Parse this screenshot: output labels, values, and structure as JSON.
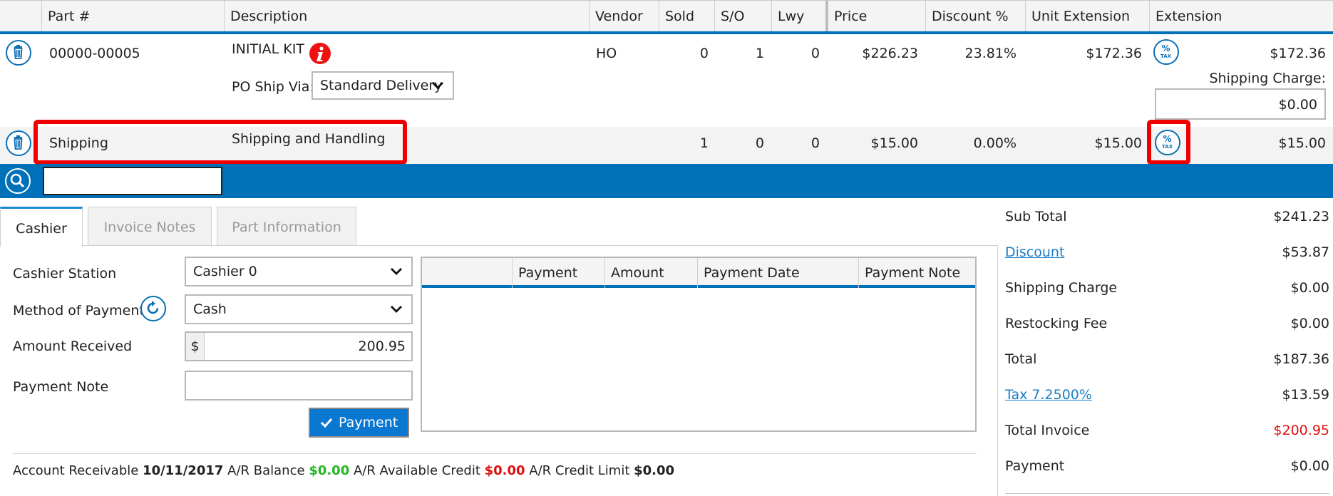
{
  "grid": {
    "columns": [
      "Part #",
      "Description",
      "Vendor",
      "Sold",
      "S/O",
      "Lwy",
      "Price",
      "Discount %",
      "Unit Extension",
      "Extension"
    ],
    "rows": [
      {
        "part": "00000-00005",
        "description": "INITIAL KIT",
        "vendor": "HO",
        "sold": "0",
        "so": "1",
        "lwy": "0",
        "price": "$226.23",
        "discount": "23.81%",
        "unit_ext": "$172.36",
        "extension": "$172.36",
        "po_ship_via_label": "PO Ship Via:",
        "po_ship_via_value": "Standard Delivery",
        "shipping_charge_label": "Shipping Charge:",
        "shipping_charge_value": "$0.00"
      },
      {
        "part": "Shipping",
        "description": "Shipping and Handling",
        "vendor": "",
        "sold": "1",
        "so": "0",
        "lwy": "0",
        "price": "$15.00",
        "discount": "0.00%",
        "unit_ext": "$15.00",
        "extension": "$15.00"
      }
    ],
    "search_value": ""
  },
  "tabs": [
    {
      "label": "Cashier",
      "active": true
    },
    {
      "label": "Invoice Notes",
      "active": false
    },
    {
      "label": "Part Information",
      "active": false
    }
  ],
  "cashier": {
    "station_label": "Cashier Station",
    "station_value": "Cashier 0",
    "method_label": "Method of Payment",
    "method_value": "Cash",
    "amount_label": "Amount Received",
    "currency_symbol": "$",
    "amount_value": "200.95",
    "note_label": "Payment Note",
    "note_value": "",
    "payment_button": "Payment",
    "payments_columns": [
      "",
      "Payment",
      "Amount",
      "Payment Date",
      "Payment Note"
    ]
  },
  "ar": {
    "label": "Account Receivable",
    "date": "10/11/2017",
    "balance_label": "A/R Balance",
    "balance": "$0.00",
    "credit_label": "A/R Available Credit",
    "credit": "$0.00",
    "limit_label": "A/R Credit Limit",
    "limit": "$0.00"
  },
  "totals": {
    "sub_total_label": "Sub Total",
    "sub_total": "$241.23",
    "discount_label": "Discount",
    "discount": "$53.87",
    "shipping_label": "Shipping Charge",
    "shipping": "$0.00",
    "restocking_label": "Restocking Fee",
    "restocking": "$0.00",
    "total_label": "Total",
    "total": "$187.36",
    "tax_label": "Tax 7.2500%",
    "tax": "$13.59",
    "total_invoice_label": "Total Invoice",
    "total_invoice": "$200.95",
    "payment_label": "Payment",
    "payment": "$0.00"
  },
  "colors": {
    "accent_blue": "#0070b8",
    "highlight_red": "#ee0000",
    "green_value": "#22b822",
    "red_value": "#e01010"
  }
}
